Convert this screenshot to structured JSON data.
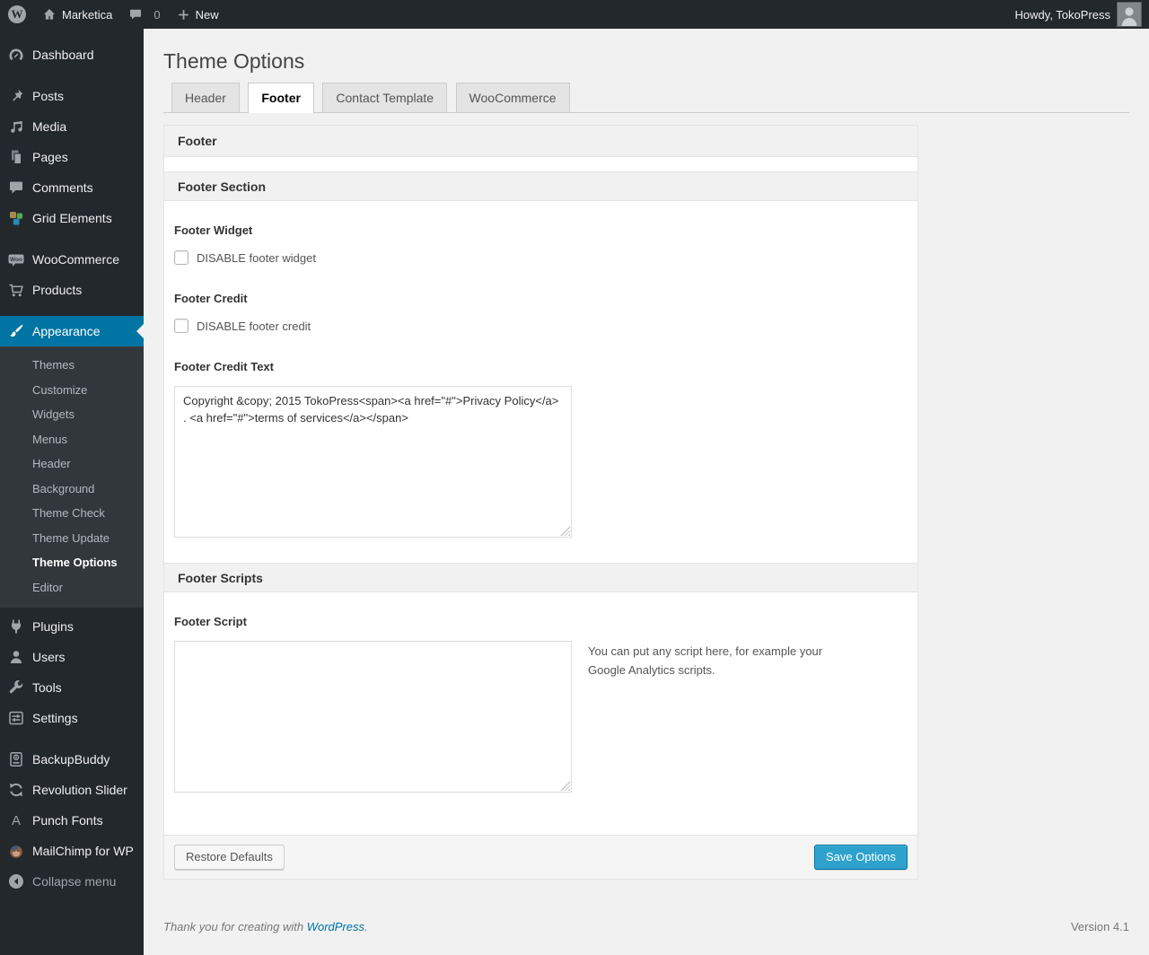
{
  "colors": {
    "accent": "#0074a2",
    "primary_button": "#2ea2cc",
    "admin_bar_bg": "#23282d",
    "submenu_bg": "#32373c",
    "page_bg": "#f1f1f1"
  },
  "admin_bar": {
    "site_name": "Marketica",
    "comment_count": "0",
    "new_label": "New",
    "howdy": "Howdy, TokoPress"
  },
  "sidebar": {
    "dashboard": "Dashboard",
    "posts": "Posts",
    "media": "Media",
    "pages": "Pages",
    "comments": "Comments",
    "grid_elements": "Grid Elements",
    "woocommerce": "WooCommerce",
    "products": "Products",
    "appearance": "Appearance",
    "appearance_submenu": [
      "Themes",
      "Customize",
      "Widgets",
      "Menus",
      "Header",
      "Background",
      "Theme Check",
      "Theme Update",
      "Theme Options",
      "Editor"
    ],
    "plugins": "Plugins",
    "users": "Users",
    "tools": "Tools",
    "settings": "Settings",
    "backupbuddy": "BackupBuddy",
    "revolution_slider": "Revolution Slider",
    "punch_fonts": "Punch Fonts",
    "mailchimp": "MailChimp for WP",
    "collapse": "Collapse menu"
  },
  "main": {
    "page_title": "Theme Options",
    "tabs": {
      "header": "Header",
      "footer": "Footer",
      "contact": "Contact Template",
      "woocommerce": "WooCommerce"
    },
    "panel": {
      "box_title": "Footer",
      "section1_title": "Footer Section",
      "footer_widget_label": "Footer Widget",
      "footer_widget_checkbox": "DISABLE footer widget",
      "footer_credit_label": "Footer Credit",
      "footer_credit_checkbox": "DISABLE footer credit",
      "footer_credit_text_label": "Footer Credit Text",
      "footer_credit_text_value": "Copyright &copy; 2015 TokoPress<span><a href=\"#\">Privacy Policy</a> . <a href=\"#\">terms of services</a></span>",
      "section2_title": "Footer Scripts",
      "footer_script_label": "Footer Script",
      "footer_script_value": "",
      "footer_script_help": "You can put any script here, for example your Google Analytics scripts.",
      "restore_button": "Restore Defaults",
      "save_button": "Save Options"
    }
  },
  "footer": {
    "thanks_prefix": "Thank you for creating with ",
    "wordpress_link": "WordPress",
    "thanks_suffix": ".",
    "version": "Version 4.1"
  }
}
